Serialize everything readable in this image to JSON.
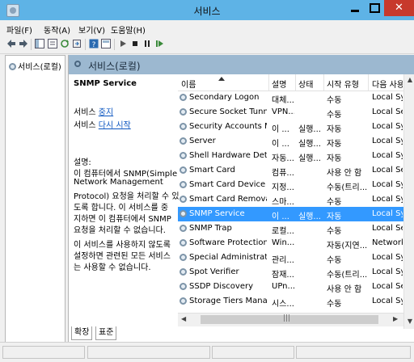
{
  "window": {
    "title": "서비스"
  },
  "menu": [
    "파일(F)",
    "동작(A)",
    "보기(V)",
    "도움말(H)"
  ],
  "toolbar_icons": [
    "back-icon",
    "forward-icon",
    "show-tree-icon",
    "properties-icon",
    "refresh-icon",
    "export-icon",
    "help-icon",
    "console-icon",
    "start-icon",
    "stop-icon",
    "pause-icon",
    "resume-icon"
  ],
  "tree": {
    "node": "서비스(로컬)"
  },
  "header": {
    "title": "서비스(로컬)"
  },
  "detail": {
    "service_name": "SNMP Service",
    "stop_prefix": "서비스 ",
    "stop_link": "중지",
    "restart_prefix": "서비스 ",
    "restart_link": "다시 시작",
    "desc_label": "설명:",
    "desc_lines": [
      "이 컴퓨터에서 SNMP(Simple",
      "Network Management",
      "Protocol) 요청을 처리할 수 있",
      "도록 합니다. 이 서비스를 중",
      "지하면 이 컴퓨터에서 SNMP",
      "요청을 처리할 수 없습니다.",
      "이 서비스를 사용하지 않도록",
      "설정하면 관련된 모든 서비스",
      "는 사용할 수 없습니다."
    ]
  },
  "columns": {
    "name": "이름",
    "desc": "설명",
    "status": "상태",
    "startup": "시작 유형",
    "logon": "다음 사용자로 로그온"
  },
  "rows": [
    {
      "name": "Secondary Logon",
      "desc": "대체...",
      "status": "",
      "startup": "수동",
      "logon": "Local Sys"
    },
    {
      "name": "Secure Socket Tunnel...",
      "desc": "VPN...",
      "status": "",
      "startup": "수동",
      "logon": "Local Ser"
    },
    {
      "name": "Security Accounts Ma...",
      "desc": "이 ...",
      "status": "실행...",
      "startup": "자동",
      "logon": "Local Sys"
    },
    {
      "name": "Server",
      "desc": "이 ...",
      "status": "실행...",
      "startup": "자동",
      "logon": "Local Sys"
    },
    {
      "name": "Shell Hardware Detec...",
      "desc": "자동...",
      "status": "실행...",
      "startup": "자동",
      "logon": "Local Sys"
    },
    {
      "name": "Smart Card",
      "desc": "컴퓨...",
      "status": "",
      "startup": "사용 안 함",
      "logon": "Local Ser"
    },
    {
      "name": "Smart Card Device E...",
      "desc": "지정...",
      "status": "",
      "startup": "수동(트리...",
      "logon": "Local Sys"
    },
    {
      "name": "Smart Card Removal ...",
      "desc": "스마...",
      "status": "",
      "startup": "수동",
      "logon": "Local Sys"
    },
    {
      "name": "SNMP Service",
      "desc": "이 ...",
      "status": "실행...",
      "startup": "자동",
      "logon": "Local Sys"
    },
    {
      "name": "SNMP Trap",
      "desc": "로컬...",
      "status": "",
      "startup": "수동",
      "logon": "Local Ser"
    },
    {
      "name": "Software Protection",
      "desc": "Win...",
      "status": "",
      "startup": "자동(지연...",
      "logon": "Network"
    },
    {
      "name": "Special Administratio...",
      "desc": "관리...",
      "status": "",
      "startup": "수동",
      "logon": "Local Sys"
    },
    {
      "name": "Spot Verifier",
      "desc": "잠재...",
      "status": "",
      "startup": "수동(트리...",
      "logon": "Local Sys"
    },
    {
      "name": "SSDP Discovery",
      "desc": "UPn...",
      "status": "",
      "startup": "사용 안 함",
      "logon": "Local Ser"
    },
    {
      "name": "Storage Tiers Manag...",
      "desc": "시스...",
      "status": "",
      "startup": "수동",
      "logon": "Local Sys"
    }
  ],
  "tabs": [
    "확장",
    "표준"
  ],
  "colors": {
    "titlebar": "#5eb3e6",
    "selection": "#3399ff",
    "header_band": "#9cb8d0",
    "close": "#c7392c"
  }
}
